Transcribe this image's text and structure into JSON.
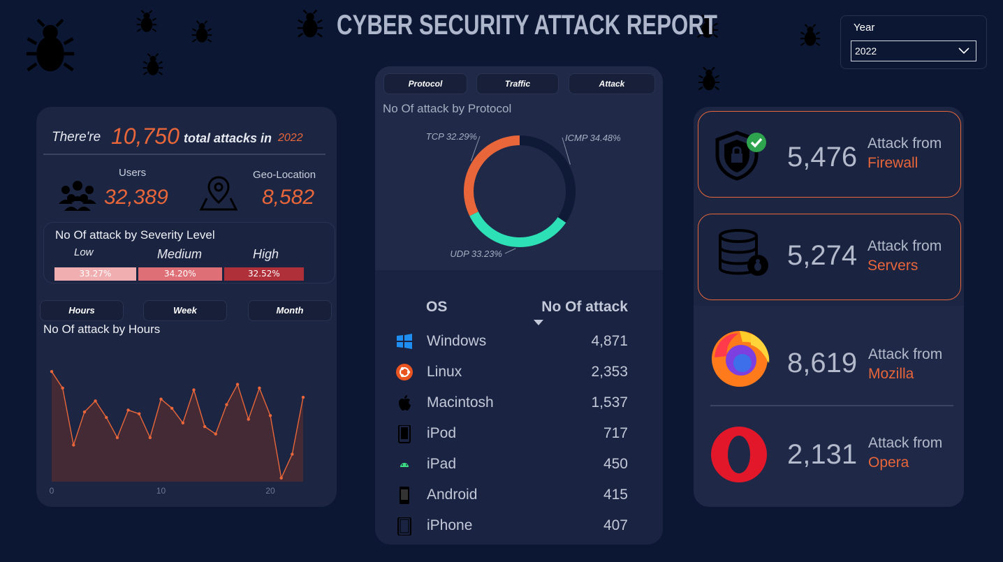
{
  "header": {
    "title": "CYBER SECURITY ATTACK REPORT"
  },
  "year_filter": {
    "label": "Year",
    "selected": "2022"
  },
  "summary": {
    "prefix": "There're",
    "total": "10,750",
    "middle": "total attacks in",
    "year": "2022",
    "users_label": "Users",
    "users_value": "32,389",
    "geo_label": "Geo-Location",
    "geo_value": "8,582"
  },
  "severity": {
    "title": "No Of attack by Severity Level",
    "levels": [
      {
        "name": "Low",
        "pct": "33.27%",
        "value": 33.27,
        "color": "#f0aeb0"
      },
      {
        "name": "Medium",
        "pct": "34.20%",
        "value": 34.2,
        "color": "#df6f77"
      },
      {
        "name": "High",
        "pct": "32.52%",
        "value": 32.52,
        "color": "#b0303a"
      }
    ]
  },
  "time_tabs": [
    "Hours",
    "Week",
    "Month"
  ],
  "protocol_tabs": [
    "Protocol",
    "Traffic",
    "Attack"
  ],
  "chart_data": [
    {
      "type": "pie",
      "title": "No Of attack by Protocol",
      "labels": [
        "ICMP",
        "UDP",
        "TCP"
      ],
      "values": [
        34.48,
        33.23,
        32.29
      ],
      "label_texts": [
        "ICMP 34.48%",
        "UDP 33.23%",
        "TCP 32.29%"
      ],
      "colors": [
        "#0f1a36",
        "#2de0b5",
        "#e8663a"
      ],
      "donut": true
    },
    {
      "type": "area",
      "title": "No Of attack by Hours",
      "x": [
        0,
        1,
        2,
        3,
        4,
        5,
        6,
        7,
        8,
        9,
        10,
        11,
        12,
        13,
        14,
        15,
        16,
        17,
        18,
        19,
        20,
        21,
        22,
        23
      ],
      "y": [
        497,
        488,
        457,
        475,
        481,
        472,
        461,
        476,
        474,
        461,
        482,
        477,
        469,
        487,
        467,
        463,
        479,
        490,
        471,
        488,
        473,
        439,
        452,
        483
      ],
      "xticks": [
        0,
        10,
        20
      ],
      "ylim": [
        437,
        510
      ],
      "grid": false,
      "color": "#e8663a"
    }
  ],
  "os_table": {
    "col_os": "OS",
    "col_count": "No Of attack",
    "rows": [
      {
        "name": "Windows",
        "value": "4,871",
        "icon": "windows-icon"
      },
      {
        "name": "Linux",
        "value": "2,353",
        "icon": "ubuntu-icon"
      },
      {
        "name": "Macintosh",
        "value": "1,537",
        "icon": "apple-icon"
      },
      {
        "name": "iPod",
        "value": "717",
        "icon": "ipod-icon"
      },
      {
        "name": "iPad",
        "value": "450",
        "icon": "android-icon"
      },
      {
        "name": "Android",
        "value": "415",
        "icon": "phone-icon"
      },
      {
        "name": "iPhone",
        "value": "407",
        "icon": "iphone-icon"
      }
    ]
  },
  "sources": [
    {
      "value": "5,476",
      "label": "Attack from",
      "name": "Firewall",
      "icon": "shield-lock-icon"
    },
    {
      "value": "5,274",
      "label": "Attack from",
      "name": "Servers",
      "icon": "database-icon"
    },
    {
      "value": "8,619",
      "label": "Attack from",
      "name": "Mozilla",
      "icon": "firefox-icon"
    },
    {
      "value": "2,131",
      "label": "Attack from",
      "name": "Opera",
      "icon": "opera-icon"
    }
  ],
  "colors": {
    "accent": "#e8663a",
    "teal": "#2de0b5",
    "background": "#0b1733",
    "card": "#1c2643"
  }
}
